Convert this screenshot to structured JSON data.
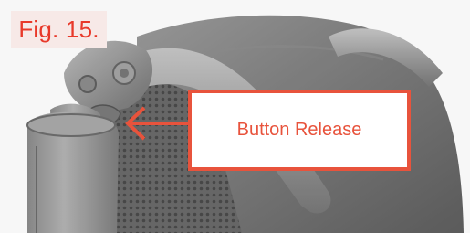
{
  "figure": {
    "label": "Fig. 15.",
    "callout_text": "Button Release",
    "accent_color": "#e8533c",
    "label_color": "#e8392a",
    "photo_subject": "wheelchair-backrest-release-button-photo"
  }
}
